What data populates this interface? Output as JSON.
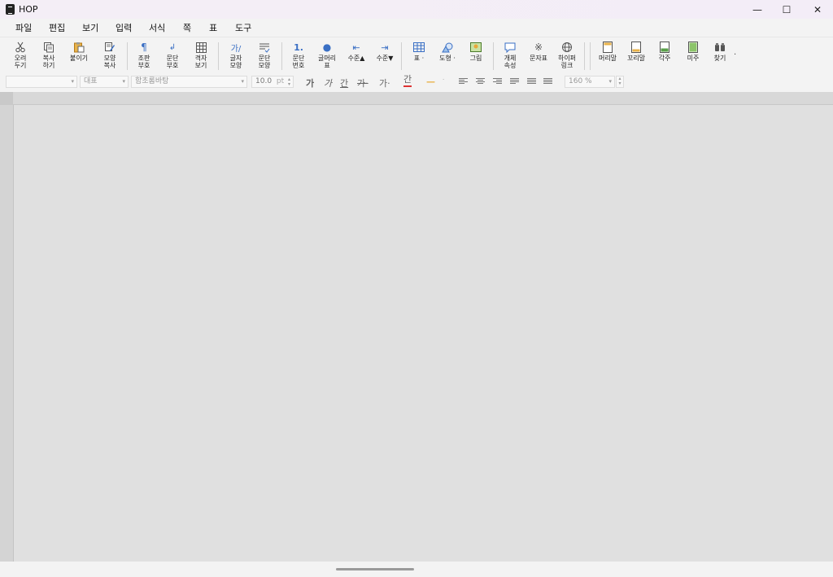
{
  "window": {
    "title": "HOP",
    "minimize": "—",
    "maximize": "☐",
    "close": "✕"
  },
  "menu": [
    "파일",
    "편집",
    "보기",
    "입력",
    "서식",
    "쪽",
    "표",
    "도구"
  ],
  "toolbar": [
    {
      "label": "오려\n두기",
      "icon": "scissors-icon"
    },
    {
      "label": "복사\n하기",
      "icon": "copy-icon"
    },
    {
      "label": "붙이기",
      "icon": "paste-icon"
    },
    {
      "label": "모양\n복사",
      "icon": "format-painter-icon"
    },
    {
      "label": "조판\n부호",
      "icon": "pilcrow-icon"
    },
    {
      "label": "문단\n부호",
      "icon": "return-arrow-icon"
    },
    {
      "label": "격자\n보기",
      "icon": "grid-icon"
    },
    {
      "label": "글자\n모양",
      "icon": "char-shape-icon"
    },
    {
      "label": "문단\n모양",
      "icon": "para-shape-icon"
    },
    {
      "label": "문단\n번호",
      "icon": "numbering-icon"
    },
    {
      "label": "글머리\n표",
      "icon": "bullet-icon"
    },
    {
      "label": "수준▲",
      "icon": "outdent-icon"
    },
    {
      "label": "수준▼",
      "icon": "indent-icon"
    },
    {
      "label": "표 ·",
      "icon": "table-icon"
    },
    {
      "label": "도형 ·",
      "icon": "shape-icon"
    },
    {
      "label": "그림",
      "icon": "picture-icon"
    },
    {
      "label": "개체\n속성",
      "icon": "object-props-icon"
    },
    {
      "label": "문자표",
      "icon": "symbol-icon"
    },
    {
      "label": "하이퍼\n링크",
      "icon": "hyperlink-icon"
    },
    {
      "label": "머리말",
      "icon": "header-icon"
    },
    {
      "label": "꼬리말",
      "icon": "footer-icon"
    },
    {
      "label": "각주",
      "icon": "footnote-icon"
    },
    {
      "label": "미주",
      "icon": "endnote-icon"
    },
    {
      "label": "찾기",
      "icon": "binoculars-icon"
    }
  ],
  "toolbar_more": "·",
  "format": {
    "style": "",
    "lang": "대표",
    "font": "함초롬바탕",
    "size": "10.0",
    "unit": "pt",
    "bold": "가",
    "italic": "가",
    "underline": "간",
    "strike": "가·",
    "super": "가·",
    "color": "간",
    "highlight": "—",
    "zoom": "160 %"
  }
}
